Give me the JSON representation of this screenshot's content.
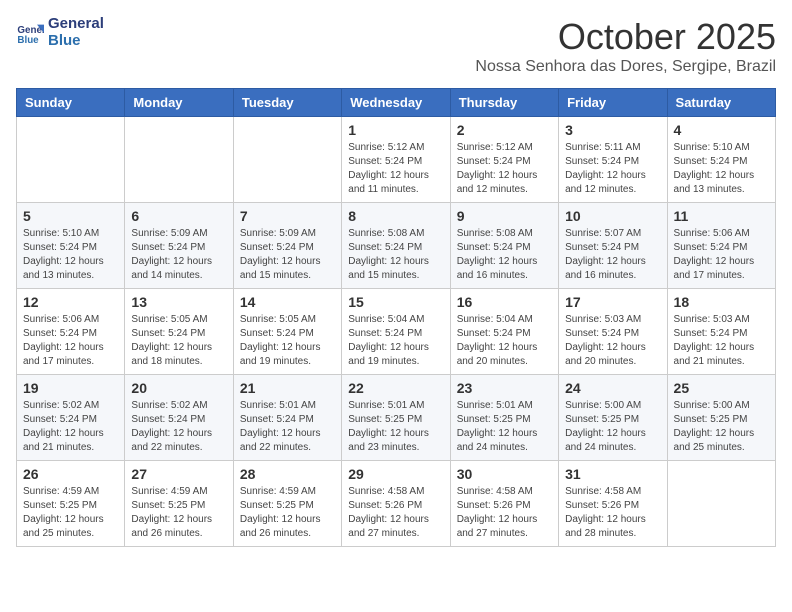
{
  "header": {
    "logo_line1": "General",
    "logo_line2": "Blue",
    "month": "October 2025",
    "location": "Nossa Senhora das Dores, Sergipe, Brazil"
  },
  "weekdays": [
    "Sunday",
    "Monday",
    "Tuesday",
    "Wednesday",
    "Thursday",
    "Friday",
    "Saturday"
  ],
  "weeks": [
    [
      {
        "day": "",
        "info": ""
      },
      {
        "day": "",
        "info": ""
      },
      {
        "day": "",
        "info": ""
      },
      {
        "day": "1",
        "info": "Sunrise: 5:12 AM\nSunset: 5:24 PM\nDaylight: 12 hours\nand 11 minutes."
      },
      {
        "day": "2",
        "info": "Sunrise: 5:12 AM\nSunset: 5:24 PM\nDaylight: 12 hours\nand 12 minutes."
      },
      {
        "day": "3",
        "info": "Sunrise: 5:11 AM\nSunset: 5:24 PM\nDaylight: 12 hours\nand 12 minutes."
      },
      {
        "day": "4",
        "info": "Sunrise: 5:10 AM\nSunset: 5:24 PM\nDaylight: 12 hours\nand 13 minutes."
      }
    ],
    [
      {
        "day": "5",
        "info": "Sunrise: 5:10 AM\nSunset: 5:24 PM\nDaylight: 12 hours\nand 13 minutes."
      },
      {
        "day": "6",
        "info": "Sunrise: 5:09 AM\nSunset: 5:24 PM\nDaylight: 12 hours\nand 14 minutes."
      },
      {
        "day": "7",
        "info": "Sunrise: 5:09 AM\nSunset: 5:24 PM\nDaylight: 12 hours\nand 15 minutes."
      },
      {
        "day": "8",
        "info": "Sunrise: 5:08 AM\nSunset: 5:24 PM\nDaylight: 12 hours\nand 15 minutes."
      },
      {
        "day": "9",
        "info": "Sunrise: 5:08 AM\nSunset: 5:24 PM\nDaylight: 12 hours\nand 16 minutes."
      },
      {
        "day": "10",
        "info": "Sunrise: 5:07 AM\nSunset: 5:24 PM\nDaylight: 12 hours\nand 16 minutes."
      },
      {
        "day": "11",
        "info": "Sunrise: 5:06 AM\nSunset: 5:24 PM\nDaylight: 12 hours\nand 17 minutes."
      }
    ],
    [
      {
        "day": "12",
        "info": "Sunrise: 5:06 AM\nSunset: 5:24 PM\nDaylight: 12 hours\nand 17 minutes."
      },
      {
        "day": "13",
        "info": "Sunrise: 5:05 AM\nSunset: 5:24 PM\nDaylight: 12 hours\nand 18 minutes."
      },
      {
        "day": "14",
        "info": "Sunrise: 5:05 AM\nSunset: 5:24 PM\nDaylight: 12 hours\nand 19 minutes."
      },
      {
        "day": "15",
        "info": "Sunrise: 5:04 AM\nSunset: 5:24 PM\nDaylight: 12 hours\nand 19 minutes."
      },
      {
        "day": "16",
        "info": "Sunrise: 5:04 AM\nSunset: 5:24 PM\nDaylight: 12 hours\nand 20 minutes."
      },
      {
        "day": "17",
        "info": "Sunrise: 5:03 AM\nSunset: 5:24 PM\nDaylight: 12 hours\nand 20 minutes."
      },
      {
        "day": "18",
        "info": "Sunrise: 5:03 AM\nSunset: 5:24 PM\nDaylight: 12 hours\nand 21 minutes."
      }
    ],
    [
      {
        "day": "19",
        "info": "Sunrise: 5:02 AM\nSunset: 5:24 PM\nDaylight: 12 hours\nand 21 minutes."
      },
      {
        "day": "20",
        "info": "Sunrise: 5:02 AM\nSunset: 5:24 PM\nDaylight: 12 hours\nand 22 minutes."
      },
      {
        "day": "21",
        "info": "Sunrise: 5:01 AM\nSunset: 5:24 PM\nDaylight: 12 hours\nand 22 minutes."
      },
      {
        "day": "22",
        "info": "Sunrise: 5:01 AM\nSunset: 5:25 PM\nDaylight: 12 hours\nand 23 minutes."
      },
      {
        "day": "23",
        "info": "Sunrise: 5:01 AM\nSunset: 5:25 PM\nDaylight: 12 hours\nand 24 minutes."
      },
      {
        "day": "24",
        "info": "Sunrise: 5:00 AM\nSunset: 5:25 PM\nDaylight: 12 hours\nand 24 minutes."
      },
      {
        "day": "25",
        "info": "Sunrise: 5:00 AM\nSunset: 5:25 PM\nDaylight: 12 hours\nand 25 minutes."
      }
    ],
    [
      {
        "day": "26",
        "info": "Sunrise: 4:59 AM\nSunset: 5:25 PM\nDaylight: 12 hours\nand 25 minutes."
      },
      {
        "day": "27",
        "info": "Sunrise: 4:59 AM\nSunset: 5:25 PM\nDaylight: 12 hours\nand 26 minutes."
      },
      {
        "day": "28",
        "info": "Sunrise: 4:59 AM\nSunset: 5:25 PM\nDaylight: 12 hours\nand 26 minutes."
      },
      {
        "day": "29",
        "info": "Sunrise: 4:58 AM\nSunset: 5:26 PM\nDaylight: 12 hours\nand 27 minutes."
      },
      {
        "day": "30",
        "info": "Sunrise: 4:58 AM\nSunset: 5:26 PM\nDaylight: 12 hours\nand 27 minutes."
      },
      {
        "day": "31",
        "info": "Sunrise: 4:58 AM\nSunset: 5:26 PM\nDaylight: 12 hours\nand 28 minutes."
      },
      {
        "day": "",
        "info": ""
      }
    ]
  ]
}
